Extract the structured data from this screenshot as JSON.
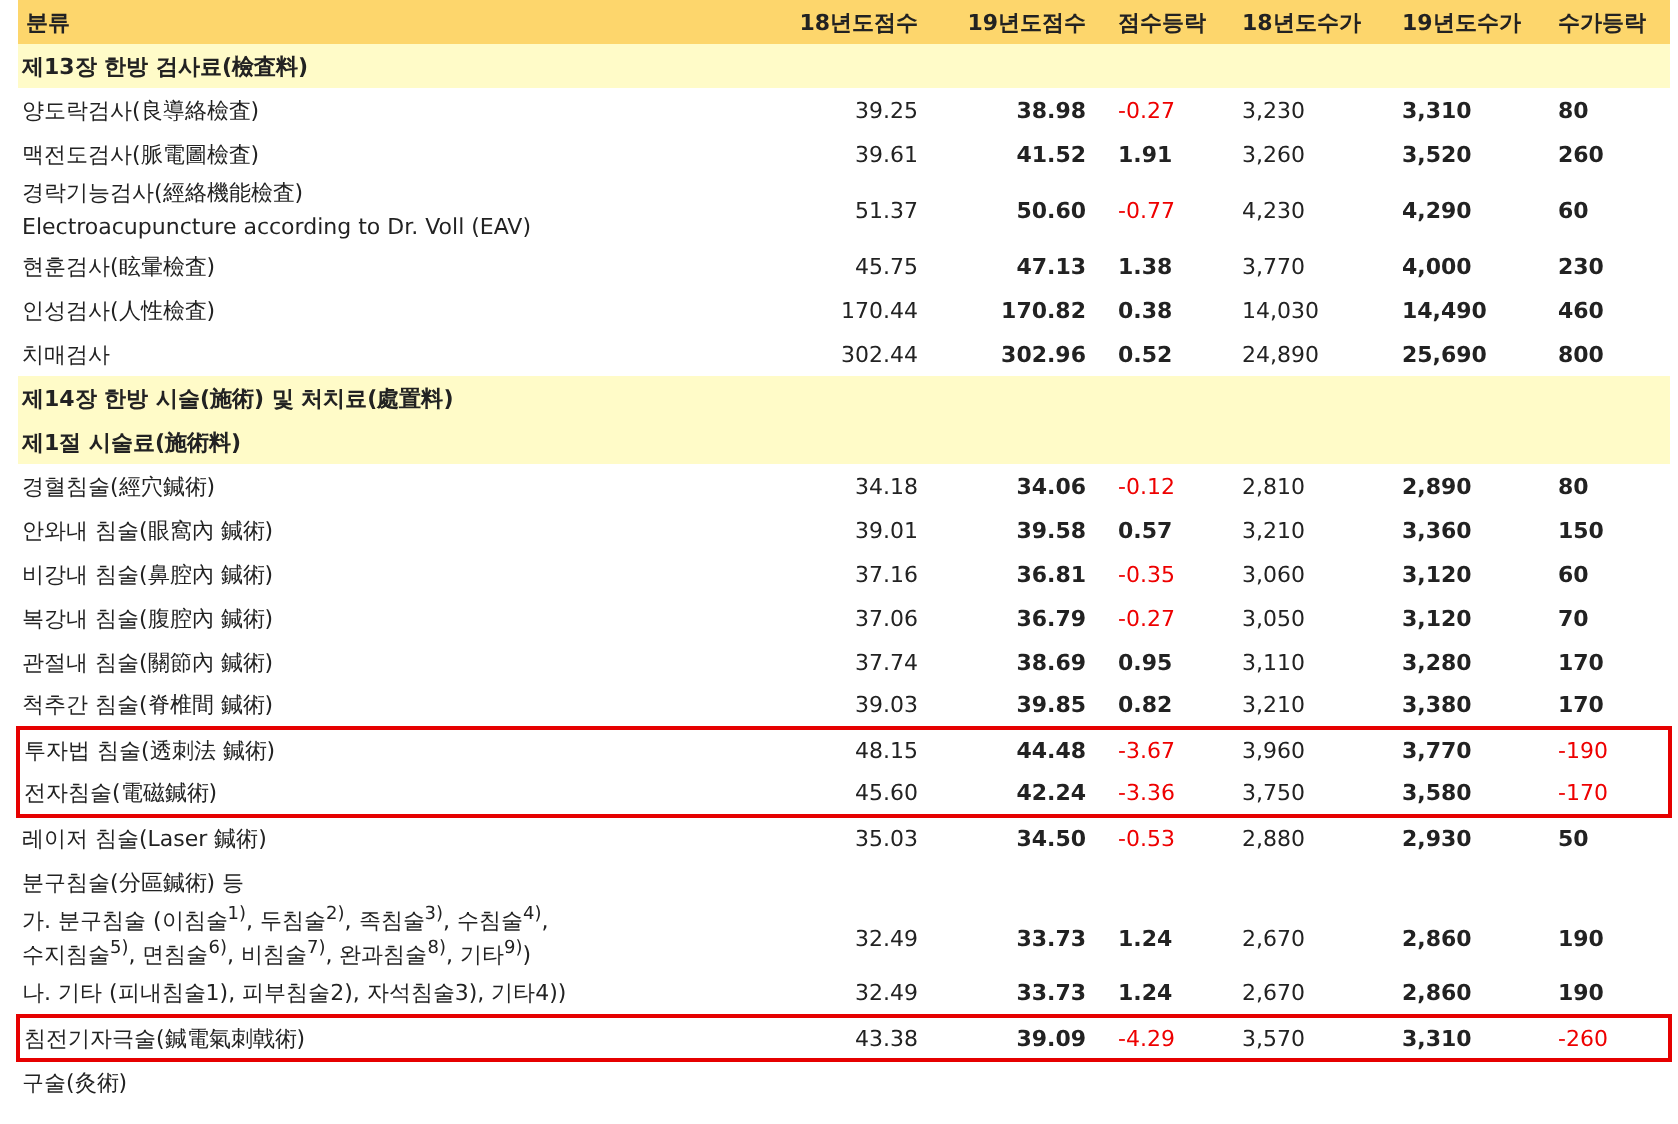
{
  "table": {
    "columns": [
      "분류",
      "18년도점수",
      "19년도점수",
      "점수등락",
      "18년도수가",
      "19년도수가",
      "수가등락"
    ],
    "rows": [
      {
        "kind": "section",
        "title": "제13장 한방 검사료(檢査料)"
      },
      {
        "kind": "item",
        "lines": [
          "양도락검사(良導絡檢査)"
        ],
        "score_18": "39.25",
        "score_19": "38.98",
        "score_change": "-0.27",
        "score_down": true,
        "fee_18": "3,230",
        "fee_19": "3,310",
        "fee_change": "80",
        "fee_down": false,
        "flagged": false
      },
      {
        "kind": "item",
        "lines": [
          "맥전도검사(脈電圖檢査)"
        ],
        "score_18": "39.61",
        "score_19": "41.52",
        "score_change": "1.91",
        "score_down": false,
        "fee_18": "3,260",
        "fee_19": "3,520",
        "fee_change": "260",
        "fee_down": false,
        "flagged": false
      },
      {
        "kind": "item",
        "lines": [
          "경락기능검사(經絡機能檢査)",
          "Electroacupuncture according to Dr. Voll (EAV)"
        ],
        "score_18": "51.37",
        "score_19": "50.60",
        "score_change": "-0.77",
        "score_down": true,
        "fee_18": "4,230",
        "fee_19": "4,290",
        "fee_change": "60",
        "fee_down": false,
        "flagged": false
      },
      {
        "kind": "item",
        "lines": [
          "현훈검사(眩暈檢査)"
        ],
        "score_18": "45.75",
        "score_19": "47.13",
        "score_change": "1.38",
        "score_down": false,
        "fee_18": "3,770",
        "fee_19": "4,000",
        "fee_change": "230",
        "fee_down": false,
        "flagged": false
      },
      {
        "kind": "item",
        "lines": [
          "인성검사(人性檢査)"
        ],
        "score_18": "170.44",
        "score_19": "170.82",
        "score_change": "0.38",
        "score_down": false,
        "fee_18": "14,030",
        "fee_19": "14,490",
        "fee_change": "460",
        "fee_down": false,
        "flagged": false
      },
      {
        "kind": "item",
        "lines": [
          "치매검사"
        ],
        "score_18": "302.44",
        "score_19": "302.96",
        "score_change": "0.52",
        "score_down": false,
        "fee_18": "24,890",
        "fee_19": "25,690",
        "fee_change": "800",
        "fee_down": false,
        "flagged": false
      },
      {
        "kind": "section",
        "title": "제14장 한방 시술(施術) 및 처치료(處置料)"
      },
      {
        "kind": "section",
        "title": "제1절 시술료(施術料)"
      },
      {
        "kind": "item",
        "lines": [
          "경혈침술(經穴鍼術)"
        ],
        "score_18": "34.18",
        "score_19": "34.06",
        "score_change": "-0.12",
        "score_down": true,
        "fee_18": "2,810",
        "fee_19": "2,890",
        "fee_change": "80",
        "fee_down": false,
        "flagged": false
      },
      {
        "kind": "item",
        "lines": [
          "안와내 침술(眼窩內 鍼術)"
        ],
        "score_18": "39.01",
        "score_19": "39.58",
        "score_change": "0.57",
        "score_down": false,
        "fee_18": "3,210",
        "fee_19": "3,360",
        "fee_change": "150",
        "fee_down": false,
        "flagged": false
      },
      {
        "kind": "item",
        "lines": [
          "비강내 침술(鼻腔內 鍼術)"
        ],
        "score_18": "37.16",
        "score_19": "36.81",
        "score_change": "-0.35",
        "score_down": true,
        "fee_18": "3,060",
        "fee_19": "3,120",
        "fee_change": "60",
        "fee_down": false,
        "flagged": false
      },
      {
        "kind": "item",
        "lines": [
          "복강내 침술(腹腔內 鍼術)"
        ],
        "score_18": "37.06",
        "score_19": "36.79",
        "score_change": "-0.27",
        "score_down": true,
        "fee_18": "3,050",
        "fee_19": "3,120",
        "fee_change": "70",
        "fee_down": false,
        "flagged": false
      },
      {
        "kind": "item",
        "lines": [
          "관절내 침술(關節內 鍼術)"
        ],
        "score_18": "37.74",
        "score_19": "38.69",
        "score_change": "0.95",
        "score_down": false,
        "fee_18": "3,110",
        "fee_19": "3,280",
        "fee_change": "170",
        "fee_down": false,
        "flagged": false
      },
      {
        "kind": "item",
        "lines": [
          "척추간 침술(脊椎間 鍼術)"
        ],
        "score_18": "39.03",
        "score_19": "39.85",
        "score_change": "0.82",
        "score_down": false,
        "fee_18": "3,210",
        "fee_19": "3,380",
        "fee_change": "170",
        "fee_down": false,
        "flagged": false
      },
      {
        "kind": "item",
        "lines": [
          "투자법 침술(透刺法 鍼術)"
        ],
        "score_18": "48.15",
        "score_19": "44.48",
        "score_change": "-3.67",
        "score_down": true,
        "fee_18": "3,960",
        "fee_19": "3,770",
        "fee_change": "-190",
        "fee_down": true,
        "flagged": true
      },
      {
        "kind": "item",
        "lines": [
          "전자침술(電磁鍼術)"
        ],
        "score_18": "45.60",
        "score_19": "42.24",
        "score_change": "-3.36",
        "score_down": true,
        "fee_18": "3,750",
        "fee_19": "3,580",
        "fee_change": "-170",
        "fee_down": true,
        "flagged": true
      },
      {
        "kind": "item",
        "lines": [
          "레이저 침술(Laser 鍼術)"
        ],
        "score_18": "35.03",
        "score_19": "34.50",
        "score_change": "-0.53",
        "score_down": true,
        "fee_18": "2,880",
        "fee_19": "2,930",
        "fee_change": "50",
        "fee_down": false,
        "flagged": false
      },
      {
        "kind": "item",
        "lines": [
          "분구침술(分區鍼術) 등"
        ],
        "flagged": false
      },
      {
        "kind": "item",
        "lines": [
          "가. 분구침술 (이침술$^{1)}$, 두침술$^{2)}$, 족침술$^{3)}$, 수침술$^{4)}$,",
          "수지침술$^{5)}$, 면침술$^{6)}$, 비침술$^{7)}$, 완과침술$^{8)}$, 기타$^{9)}$)"
        ],
        "score_18": "32.49",
        "score_19": "33.73",
        "score_change": "1.24",
        "score_down": false,
        "fee_18": "2,670",
        "fee_19": "2,860",
        "fee_change": "190",
        "fee_down": false,
        "flagged": false
      },
      {
        "kind": "item",
        "lines": [
          "나. 기타 (피내침술1), 피부침술2), 자석침술3), 기타4))"
        ],
        "score_18": "32.49",
        "score_19": "33.73",
        "score_change": "1.24",
        "score_down": false,
        "fee_18": "2,670",
        "fee_19": "2,860",
        "fee_change": "190",
        "fee_down": false,
        "flagged": false
      },
      {
        "kind": "item",
        "lines": [
          "침전기자극술(鍼電氣刺戟術)"
        ],
        "score_18": "43.38",
        "score_19": "39.09",
        "score_change": "-4.29",
        "score_down": true,
        "fee_18": "3,570",
        "fee_19": "3,310",
        "fee_change": "-260",
        "fee_down": true,
        "flagged": true
      },
      {
        "kind": "item",
        "lines": [
          "구술(灸術)"
        ],
        "flagged": false
      }
    ]
  }
}
